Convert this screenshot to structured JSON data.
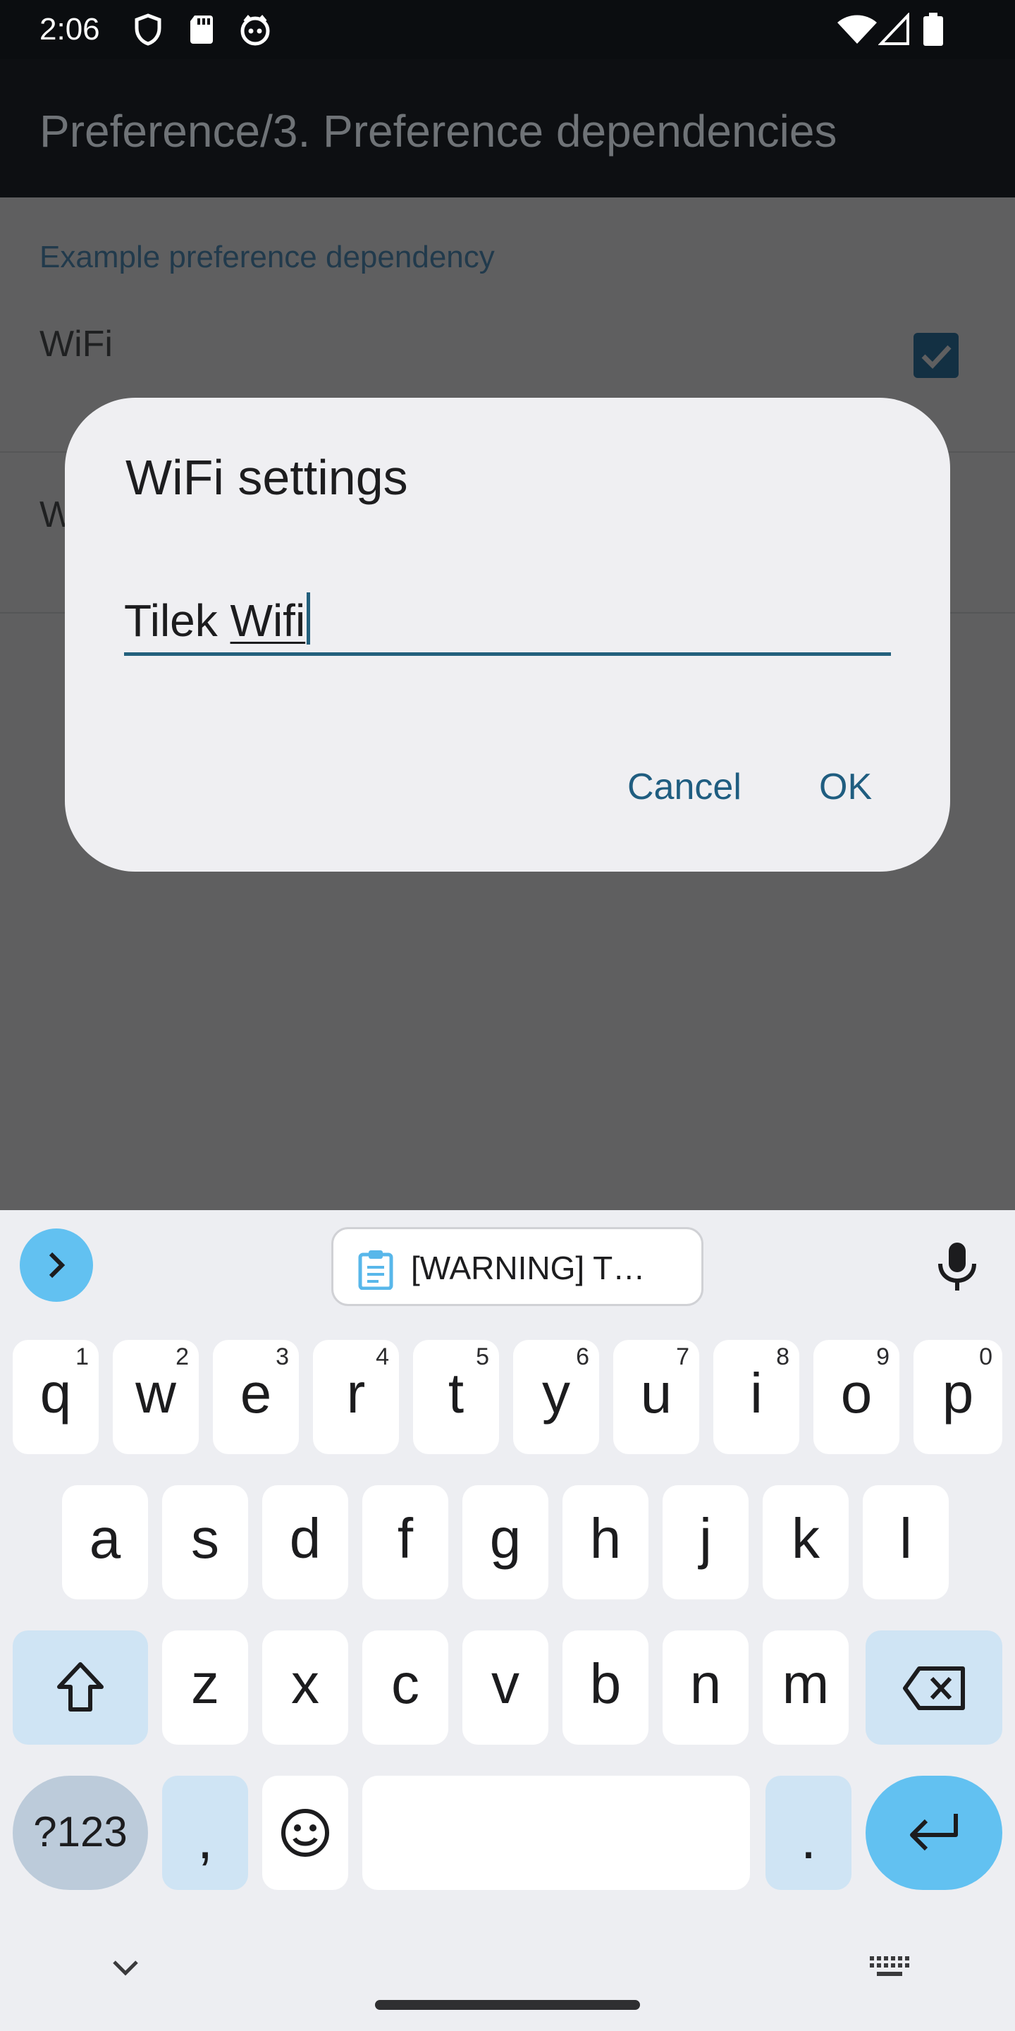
{
  "status_bar": {
    "time": "2:06",
    "icons": [
      "shield-icon",
      "sd-card-icon",
      "cat-face-icon",
      "wifi-icon",
      "signal-icon",
      "battery-icon"
    ]
  },
  "app_bar": {
    "title": "Preference/3. Preference dependencies"
  },
  "content": {
    "category": "Example preference dependency",
    "rows": [
      {
        "title": "WiFi",
        "checked": true
      },
      {
        "title": "W"
      }
    ]
  },
  "dialog": {
    "title": "WiFi settings",
    "input_value_plain": "Tilek ",
    "input_value_underlined": "Wifi",
    "cancel_label": "Cancel",
    "ok_label": "OK"
  },
  "keyboard": {
    "clipboard_text": "[WARNING] T…",
    "row1": [
      {
        "k": "q",
        "h": "1"
      },
      {
        "k": "w",
        "h": "2"
      },
      {
        "k": "e",
        "h": "3"
      },
      {
        "k": "r",
        "h": "4"
      },
      {
        "k": "t",
        "h": "5"
      },
      {
        "k": "y",
        "h": "6"
      },
      {
        "k": "u",
        "h": "7"
      },
      {
        "k": "i",
        "h": "8"
      },
      {
        "k": "o",
        "h": "9"
      },
      {
        "k": "p",
        "h": "0"
      }
    ],
    "row2": [
      "a",
      "s",
      "d",
      "f",
      "g",
      "h",
      "j",
      "k",
      "l"
    ],
    "row3": [
      "z",
      "x",
      "c",
      "v",
      "b",
      "n",
      "m"
    ],
    "symbols_label": "?123",
    "comma_label": ",",
    "period_label": "."
  },
  "colors": {
    "accent": "#23607d",
    "keyboard_accent": "#62c1f1",
    "dialog_bg": "#efeff2",
    "scrim": "#5f5f60"
  }
}
